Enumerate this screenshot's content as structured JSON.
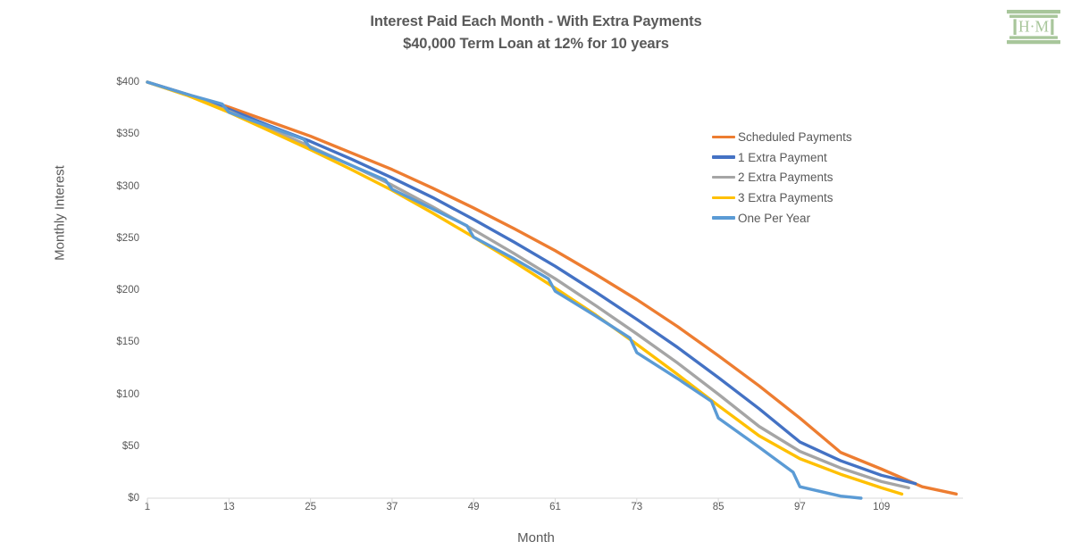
{
  "logo": {
    "text": "H·M",
    "color": "#A8C69B",
    "name": "hm-logo"
  },
  "chart_data": {
    "type": "line",
    "title": "Interest Paid Each Month - With Extra Payments",
    "subtitle": "$40,000 Term Loan at 12% for 10 years",
    "xlabel": "Month",
    "ylabel": "Monthly Interest",
    "xlim": [
      1,
      121
    ],
    "ylim": [
      0,
      400
    ],
    "grid": false,
    "legend_position": "right",
    "xticks": [
      "1",
      "13",
      "25",
      "37",
      "49",
      "61",
      "73",
      "85",
      "97",
      "109"
    ],
    "xtick_values": [
      1,
      13,
      25,
      37,
      49,
      61,
      73,
      85,
      97,
      109
    ],
    "yticks": [
      "$0",
      "$50",
      "$100",
      "$150",
      "$200",
      "$250",
      "$300",
      "$350",
      "$400"
    ],
    "ytick_values": [
      0,
      50,
      100,
      150,
      200,
      250,
      300,
      350,
      400
    ],
    "series": [
      {
        "name": "Scheduled Payments",
        "color": "#ED7D31",
        "x": [
          1,
          7,
          13,
          19,
          25,
          31,
          37,
          43,
          49,
          55,
          61,
          67,
          73,
          79,
          85,
          91,
          97,
          103,
          109,
          115,
          120
        ],
        "values": [
          400,
          388,
          376,
          362,
          348,
          332,
          316,
          298,
          279,
          259,
          238,
          215,
          191,
          165,
          137,
          108,
          77,
          44,
          28,
          11,
          4
        ]
      },
      {
        "name": "1 Extra Payment",
        "color": "#4472C4",
        "x": [
          1,
          7,
          13,
          19,
          25,
          31,
          37,
          43,
          49,
          55,
          61,
          67,
          73,
          79,
          85,
          91,
          97,
          103,
          109,
          114
        ],
        "values": [
          400,
          388,
          374,
          358,
          343,
          326,
          308,
          289,
          268,
          246,
          223,
          198,
          172,
          145,
          116,
          86,
          54,
          36,
          22,
          14
        ]
      },
      {
        "name": "2 Extra Payments",
        "color": "#A5A5A5",
        "x": [
          1,
          7,
          13,
          19,
          25,
          31,
          37,
          43,
          49,
          55,
          61,
          67,
          73,
          79,
          85,
          91,
          97,
          103,
          109,
          113
        ],
        "values": [
          400,
          387,
          372,
          355,
          338,
          320,
          301,
          280,
          258,
          235,
          211,
          185,
          158,
          130,
          100,
          69,
          45,
          29,
          16,
          10
        ]
      },
      {
        "name": "3 Extra Payments",
        "color": "#FFC000",
        "x": [
          1,
          7,
          13,
          19,
          25,
          31,
          37,
          43,
          49,
          55,
          61,
          67,
          73,
          79,
          85,
          91,
          97,
          103,
          109,
          112
        ],
        "values": [
          400,
          387,
          371,
          353,
          335,
          316,
          296,
          274,
          251,
          227,
          202,
          176,
          148,
          119,
          89,
          60,
          38,
          23,
          10,
          4
        ]
      },
      {
        "name": "One Per Year",
        "color": "#5B9BD5",
        "x": [
          1,
          7,
          12,
          13,
          19,
          24,
          25,
          31,
          36,
          37,
          43,
          48,
          49,
          55,
          60,
          61,
          67,
          72,
          73,
          79,
          84,
          85,
          91,
          96,
          97,
          103,
          106
        ],
        "values": [
          400,
          388,
          379,
          371,
          357,
          345,
          337,
          320,
          306,
          297,
          278,
          262,
          251,
          230,
          211,
          199,
          175,
          154,
          140,
          115,
          93,
          77,
          49,
          25,
          11,
          2,
          0
        ]
      }
    ]
  },
  "legend": {
    "items": [
      {
        "label": "Scheduled Payments",
        "color": "#ED7D31"
      },
      {
        "label": "1 Extra Payment",
        "color": "#4472C4"
      },
      {
        "label": "2 Extra Payments",
        "color": "#A5A5A5"
      },
      {
        "label": "3 Extra Payments",
        "color": "#FFC000"
      },
      {
        "label": "One Per Year",
        "color": "#5B9BD5"
      }
    ]
  }
}
